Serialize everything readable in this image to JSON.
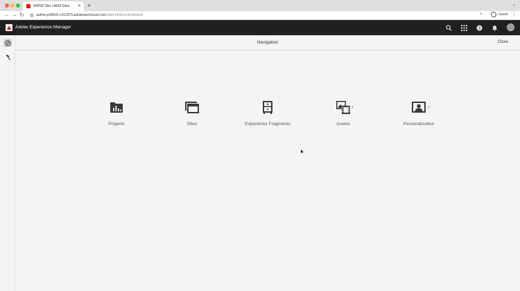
{
  "browser": {
    "tab_title": "WKND Site | AEM Sites",
    "url_host": "author-p29602-e111973.adobeaemcloud.com",
    "url_path": "/sites.html/content/wknd",
    "profile_label": "Guest"
  },
  "shell": {
    "product_title": "Adobe Experience Manager"
  },
  "navigation": {
    "title": "Navigation",
    "close_label": "Close",
    "tiles": [
      {
        "label": "Projects",
        "icon": "projects-icon",
        "has_submenu": false
      },
      {
        "label": "Sites",
        "icon": "sites-icon",
        "has_submenu": false
      },
      {
        "label": "Experience Fragments",
        "icon": "experience-fragments-icon",
        "has_submenu": false
      },
      {
        "label": "Assets",
        "icon": "assets-icon",
        "has_submenu": true
      },
      {
        "label": "Personalization",
        "icon": "personalization-icon",
        "has_submenu": true
      }
    ]
  },
  "colors": {
    "shell_bg": "#202020",
    "page_bg": "#f4f4f4",
    "icon": "#3a3a3a",
    "adobe_red": "#eb1000"
  }
}
